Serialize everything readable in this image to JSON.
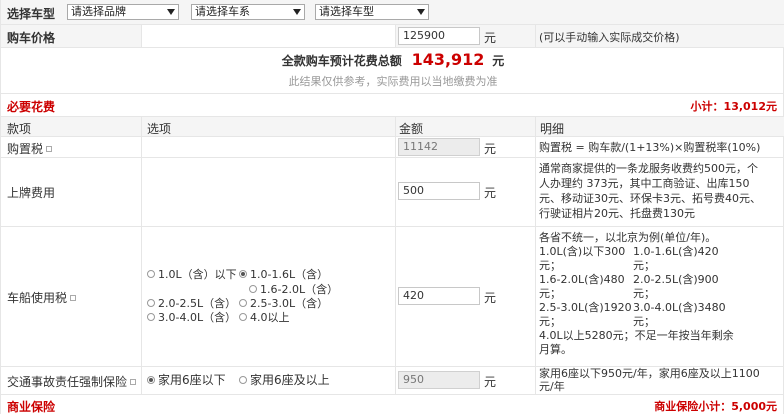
{
  "selector": {
    "label": "选择车型",
    "brand_placeholder": "请选择品牌",
    "series_placeholder": "请选择车系",
    "model_placeholder": "请选择车型"
  },
  "price": {
    "label": "购车价格",
    "value": "125900",
    "unit": "元",
    "hint": "(可以手动输入实际成交价格)"
  },
  "summary": {
    "total_label": "全款购车预计花费总额",
    "total_value": "143,912",
    "total_unit": "元",
    "note": "此结果仅供参考，实际费用以当地缴费为准"
  },
  "required": {
    "title": "必要花费",
    "subtotal": "小计：13,012元",
    "headers": [
      "款项",
      "选项",
      "金额",
      "明细"
    ],
    "purchase_tax": {
      "label": "购置税",
      "value": "11142",
      "unit": "元",
      "detail": "购置税 = 购车款/(1+13%)×购置税率(10%)"
    },
    "plate_fee": {
      "label": "上牌费用",
      "value": "500",
      "unit": "元",
      "detail_lines": [
        "通常商家提供的一条龙服务收费约500元，个",
        "人办理约 373元，其中工商验证、出库150",
        "元、移动证30元、环保卡3元、拓号费40元、",
        "行驶证相片20元、托盘费130元"
      ]
    },
    "vehicle_tax": {
      "label": "车船使用税",
      "value": "420",
      "unit": "元",
      "options": [
        "1.0L（含）以下",
        "1.0-1.6L（含）",
        "1.6-2.0L（含）",
        "2.0-2.5L（含）",
        "2.5-3.0L（含）",
        "3.0-4.0L（含）",
        "4.0以上"
      ],
      "selected": "1.0-1.6L（含）",
      "detail_lines": [
        "各省不统一，以北京为例(单位/年)。",
        "1.0L(含)以下300",
        "元；",
        "1.0-1.6L(含)420",
        "元；",
        "1.6-2.0L(含)480",
        "元；",
        "2.0-2.5L(含)900",
        "元；",
        "2.5-3.0L(含)1920",
        "元；",
        "3.0-4.0L(含)3480",
        "元；",
        "4.0L以上5280元；不足一年按当年剩余",
        "月算。"
      ]
    },
    "insurance": {
      "label": "交通事故责任强制保险",
      "options": [
        "家用6座以下",
        "家用6座及以上"
      ],
      "selected": "家用6座以下",
      "value": "950",
      "unit": "元",
      "detail_lines": [
        "家用6座以下950元/年，家用6座及以上1100",
        "元/年"
      ]
    }
  },
  "commercial": {
    "title": "商业保险",
    "subtotal": "商业保险小计：5,000元"
  },
  "colors": {
    "accent_red": "#cc0000",
    "header_bg": "#f5f5f5",
    "border": "#e6e6e6"
  }
}
